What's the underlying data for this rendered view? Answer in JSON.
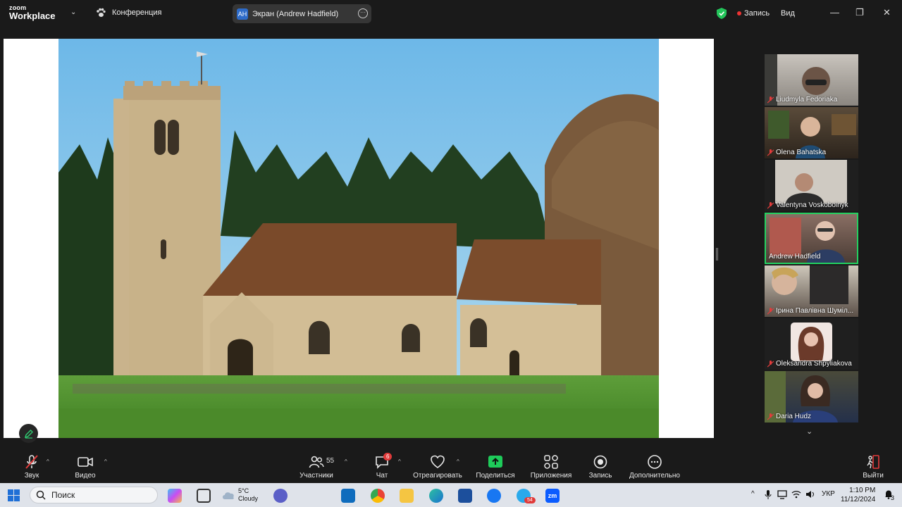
{
  "titlebar": {
    "logo_top": "zoom",
    "logo_bottom": "Workplace",
    "meeting_title": "Конференция",
    "share_initials": "AH",
    "share_label": "Экран (Andrew Hadfield)",
    "record_label": "Запись",
    "view_label": "Вид"
  },
  "participants": [
    {
      "name": "Liudmyla Fedoriaka",
      "muted": true
    },
    {
      "name": "Olena Bahatska",
      "muted": true
    },
    {
      "name": "Valentyna Voskoboinyk",
      "muted": true
    },
    {
      "name": "Andrew Hadfield",
      "muted": false,
      "active": true
    },
    {
      "name": "Ірина Павлівна Шуміл...",
      "muted": true
    },
    {
      "name": "Oleksandra Shpyliakova",
      "muted": true
    },
    {
      "name": "Daria Hudz",
      "muted": true
    }
  ],
  "toolbar": {
    "audio": "Звук",
    "video": "Видео",
    "participants": "Участники",
    "participants_count": "55",
    "chat": "Чат",
    "chat_badge": "6",
    "react": "Отреагировать",
    "share": "Поделиться",
    "apps": "Приложения",
    "record": "Запись",
    "more": "Дополнительно",
    "leave": "Выйти"
  },
  "taskbar": {
    "search_placeholder": "Поиск",
    "weather_temp": "5°C",
    "weather_desc": "Cloudy",
    "telegram_badge": "54",
    "lang": "УКР",
    "time": "1:10 PM",
    "date": "11/12/2024",
    "notif_count": "3"
  },
  "colors": {
    "active_speaker": "#23d160",
    "share_green": "#1ecb5a",
    "muted_red": "#e33b3b",
    "accent_blue": "#2d6bc9"
  }
}
